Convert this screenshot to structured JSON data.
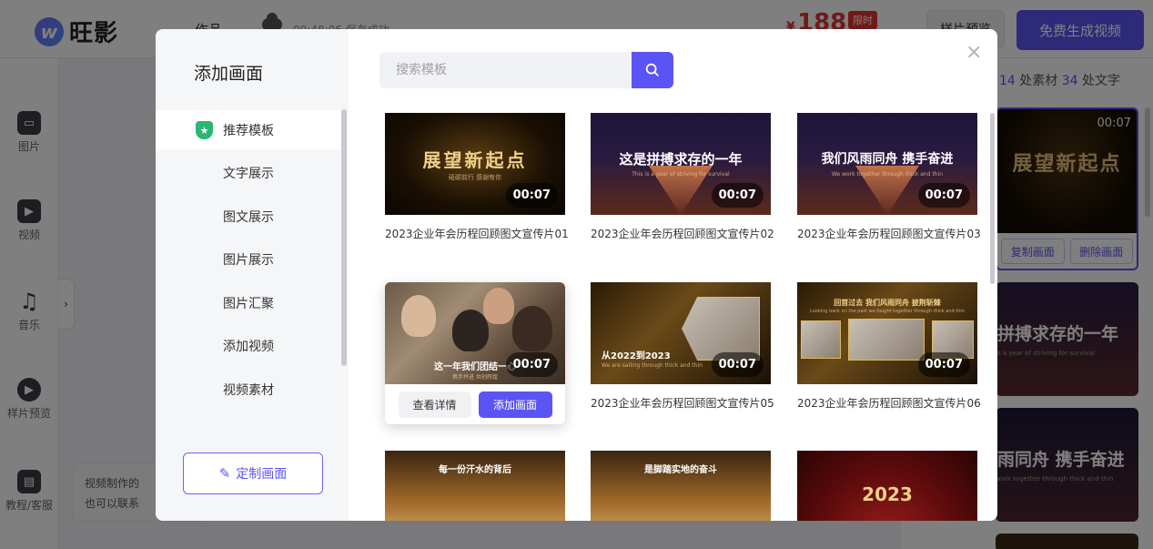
{
  "app": {
    "logo_mark": "w",
    "logo_text": "旺影",
    "work_label": "作品",
    "save_status": "09:48:06 保存成功",
    "price_currency": "¥",
    "price": "188",
    "price_badge": "限时",
    "preview_sample_label": "样片预览",
    "generate_label": "免费生成视频"
  },
  "left_rail": [
    {
      "label": "图片",
      "icon": "image-icon"
    },
    {
      "label": "视频",
      "icon": "video-icon"
    },
    {
      "label": "音乐",
      "icon": "music-icon"
    },
    {
      "label": "样片预览",
      "icon": "play-icon"
    },
    {
      "label": "教程/客服",
      "icon": "book-icon"
    }
  ],
  "collapse_glyph": "›",
  "tip": {
    "line1": "视频制作的",
    "line2": "也可以联系"
  },
  "right_panel": {
    "stats_prefix": "",
    "material_count": "14",
    "material_label": " 处素材 ",
    "text_count": "34",
    "text_label": " 处文字",
    "active_scene": {
      "title": "展望新起点",
      "duration": "00:07",
      "copy_label": "复制画面",
      "delete_label": "删除画面"
    },
    "scene2_text": "拼搏求存的一年",
    "scene3_text": "雨同舟 携手奋进",
    "scene2_sub": "is a year of striving for survival",
    "scene3_sub": "work together through thick and thin"
  },
  "modal": {
    "title": "添加画面",
    "close_glyph": "×",
    "search_placeholder": "搜索模板",
    "search_value": "",
    "categories": [
      {
        "label": "推荐模板",
        "active": true
      },
      {
        "label": "文字展示",
        "active": false
      },
      {
        "label": "图文展示",
        "active": false
      },
      {
        "label": "图片展示",
        "active": false
      },
      {
        "label": "图片汇聚",
        "active": false
      },
      {
        "label": "添加视频",
        "active": false
      },
      {
        "label": "视频素材",
        "active": false
      }
    ],
    "recommend_badge_glyph": "★",
    "custom_button_label": "定制画面",
    "hover_actions": {
      "detail_label": "查看详情",
      "add_label": "添加画面"
    },
    "templates": [
      {
        "name": "2023企业年会历程回顾图文宣传片01",
        "duration": "00:07",
        "thumb_text": "展望新起点",
        "thumb_sub": "砥砺前行 感谢有你"
      },
      {
        "name": "2023企业年会历程回顾图文宣传片02",
        "duration": "00:07",
        "thumb_text": "这是拼搏求存的一年",
        "thumb_sub": "This is a year of striving for survival"
      },
      {
        "name": "2023企业年会历程回顾图文宣传片03",
        "duration": "00:07",
        "thumb_text": "我们风雨同舟 携手奋进",
        "thumb_sub": "We work together through thick and thin"
      },
      {
        "name": "",
        "duration": "00:07",
        "thumb_text": "这一年我们团结一心",
        "thumb_sub": "携手并进 共创辉煌"
      },
      {
        "name": "2023企业年会历程回顾图文宣传片05",
        "duration": "00:07",
        "thumb_text": "从2022到2023",
        "thumb_sub": "We are sailing through thick and thin"
      },
      {
        "name": "2023企业年会历程回顾图文宣传片06",
        "duration": "00:07",
        "thumb_text": "回首过去 我们风雨同舟 披荆斩棘",
        "thumb_sub": "Looking back on the past we fought together through thick and thin"
      },
      {
        "name": "",
        "duration": "",
        "thumb_text": "每一份汗水的背后",
        "thumb_sub": ""
      },
      {
        "name": "",
        "duration": "",
        "thumb_text": "是脚踏实地的奋斗",
        "thumb_sub": ""
      },
      {
        "name": "",
        "duration": "",
        "thumb_text": "2023",
        "thumb_sub": ""
      }
    ]
  }
}
